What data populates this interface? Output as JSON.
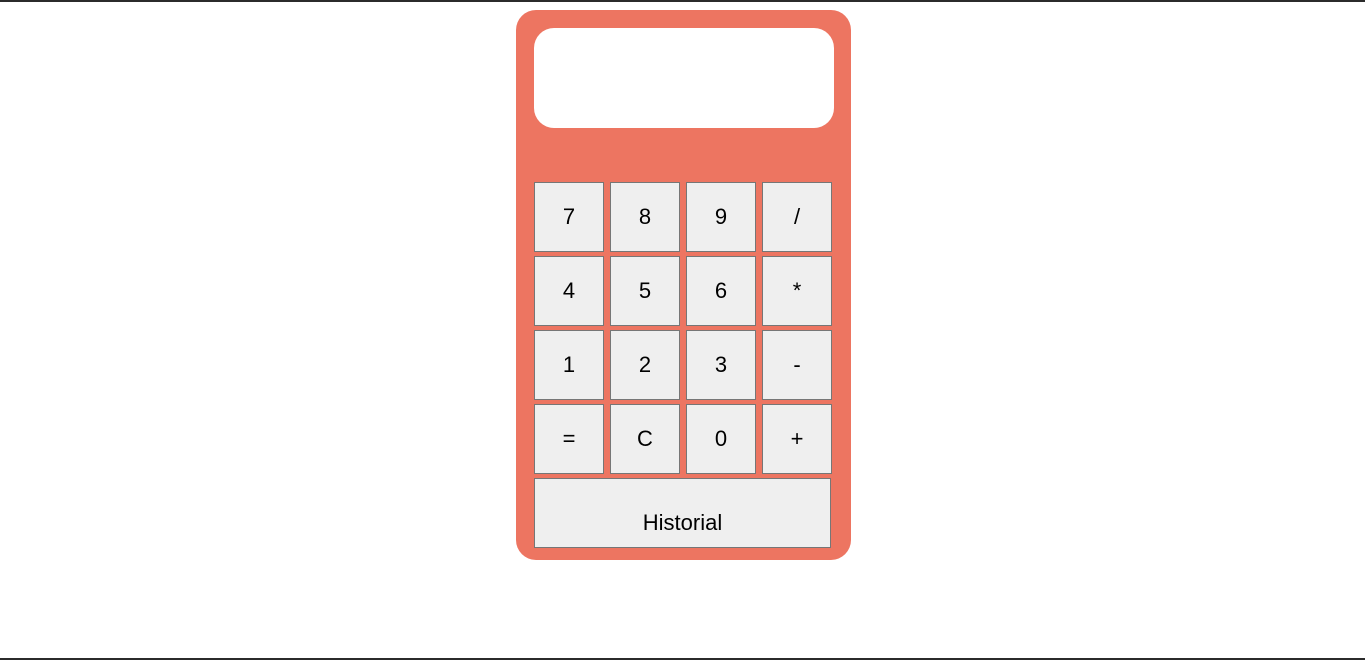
{
  "colors": {
    "calculator_body": "#ed7561",
    "display_bg": "#ffffff",
    "key_bg": "#efefef",
    "key_border": "#767676"
  },
  "display": {
    "value": ""
  },
  "keys": [
    [
      "7",
      "8",
      "9",
      "/"
    ],
    [
      "4",
      "5",
      "6",
      "*"
    ],
    [
      "1",
      "2",
      "3",
      "-"
    ],
    [
      "=",
      "C",
      "0",
      "+"
    ]
  ],
  "history_label": "Historial"
}
